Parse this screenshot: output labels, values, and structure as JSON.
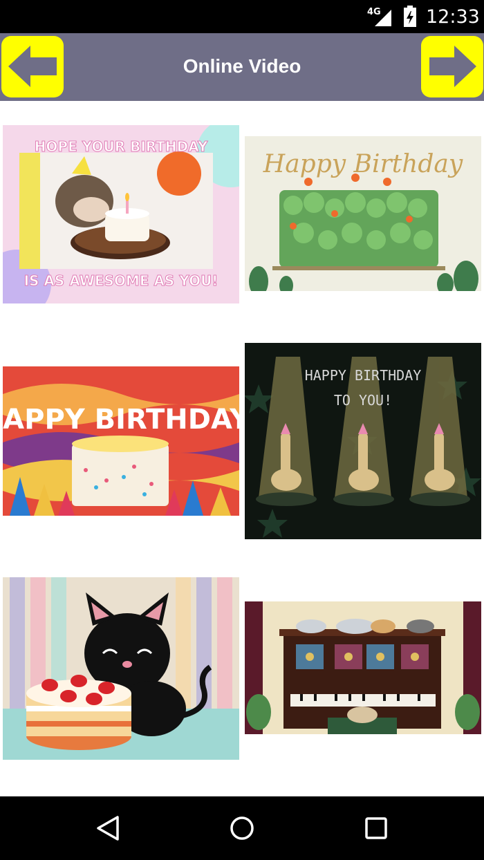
{
  "status_bar": {
    "network": "4G",
    "time": "12:33"
  },
  "header": {
    "title": "Online Video"
  },
  "videos": [
    {
      "top_text": "HOPE YOUR BIRTHDAY",
      "bottom_text": "IS AS AWESOME AS YOU!"
    },
    {
      "top_text": "Happy Birthday"
    },
    {
      "top_text": "HAPPY BIRTHDAY!"
    },
    {
      "top_text": "HAPPY BIRTHDAY",
      "bottom_text": "TO YOU!"
    },
    {},
    {}
  ],
  "colors": {
    "header_bg": "#6f6e87",
    "nav_button": "#ffff00",
    "arrow": "#6f6e87"
  }
}
